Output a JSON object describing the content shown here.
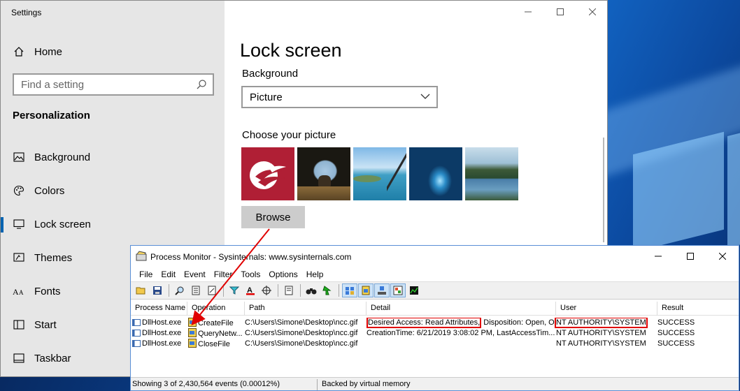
{
  "settings": {
    "title": "Settings",
    "home_label": "Home",
    "search_placeholder": "Find a setting",
    "section": "Personalization",
    "nav_items": [
      "Background",
      "Colors",
      "Lock screen",
      "Themes",
      "Fonts",
      "Start",
      "Taskbar"
    ],
    "active_item": "Lock screen",
    "main": {
      "title": "Lock screen",
      "background_label": "Background",
      "background_value": "Picture",
      "choose_picture_label": "Choose your picture",
      "browse_label": "Browse"
    }
  },
  "procmon": {
    "title": "Process Monitor - Sysinternals: www.sysinternals.com",
    "menus": [
      "File",
      "Edit",
      "Event",
      "Filter",
      "Tools",
      "Options",
      "Help"
    ],
    "columns": [
      "Process Name",
      "Operation",
      "Path",
      "Detail",
      "User",
      "Result"
    ],
    "rows": [
      {
        "process": "DllHost.exe",
        "operation": "CreateFile",
        "path": "C:\\Users\\Simone\\Desktop\\ncc.gif",
        "detail_highlight": "Desired Access: Read Attributes,",
        "detail_rest": " Disposition: Open, O...",
        "user": "NT AUTHORITY\\SYSTEM",
        "result": "SUCCESS"
      },
      {
        "process": "DllHost.exe",
        "operation": "QueryNetw...",
        "path": "C:\\Users\\Simone\\Desktop\\ncc.gif",
        "detail_highlight": "",
        "detail_rest": "CreationTime: 6/21/2019 3:08:02 PM, LastAccessTim...",
        "user": "NT AUTHORITY\\SYSTEM",
        "result": "SUCCESS"
      },
      {
        "process": "DllHost.exe",
        "operation": "CloseFile",
        "path": "C:\\Users\\Simone\\Desktop\\ncc.gif",
        "detail_highlight": "",
        "detail_rest": "",
        "user": "NT AUTHORITY\\SYSTEM",
        "result": "SUCCESS"
      }
    ],
    "status_events": "Showing 3 of 2,430,564 events (0.00012%)",
    "status_memory": "Backed by virtual memory"
  },
  "colors": {
    "accent": "#0063b1",
    "highlight": "#e00000"
  }
}
